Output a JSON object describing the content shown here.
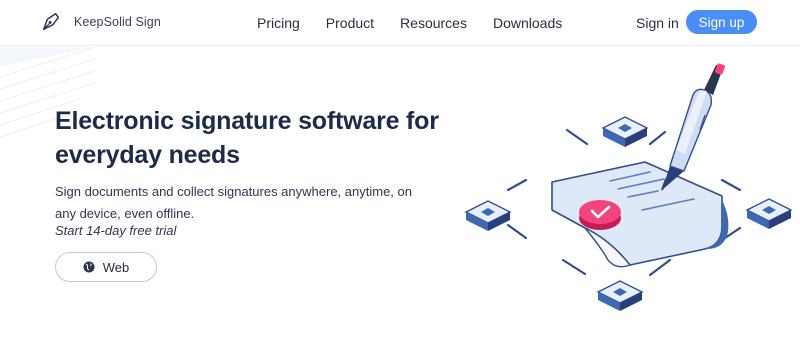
{
  "brand": {
    "name": "KeepSolid Sign"
  },
  "nav": {
    "items": [
      "Pricing",
      "Product",
      "Resources",
      "Downloads"
    ]
  },
  "auth": {
    "signin_label": "Sign in",
    "signup_label": "Sign up"
  },
  "hero": {
    "title": "Electronic signature software for everyday needs",
    "subtitle": "Sign documents and collect signatures anywhere, anytime, on any device, even offline.",
    "trial": "Start 14-day free trial",
    "platform_button": {
      "label": "Web",
      "icon": "globe-icon"
    }
  },
  "colors": {
    "accent": "#4a8ef5",
    "title": "#1e2a4a",
    "pen_tip": "#ff3f7f",
    "check_badge": "#f2457c"
  },
  "illustration": {
    "icons": [
      "pen-icon",
      "document-icon",
      "checkmark-badge-icon",
      "network-node-icon"
    ]
  }
}
